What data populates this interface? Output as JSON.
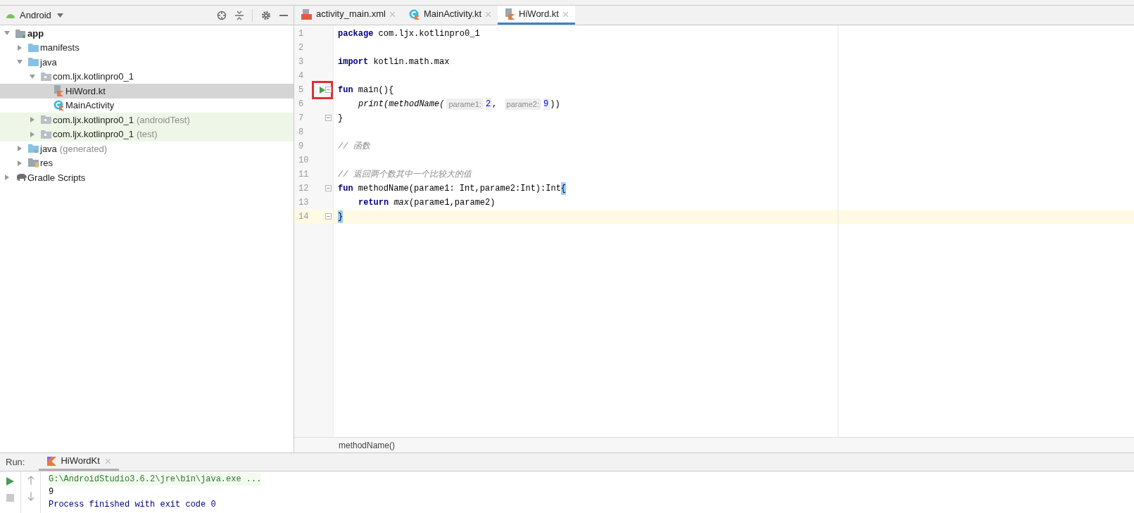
{
  "project_panel": {
    "view": "Android",
    "tree": [
      {
        "label": "app",
        "kind": "module",
        "expanded": true,
        "selected": false,
        "children": [
          {
            "label": "manifests",
            "kind": "folder",
            "expanded": false,
            "selected": false
          },
          {
            "label": "java",
            "kind": "folder",
            "expanded": true,
            "selected": false,
            "children": [
              {
                "label": "com.ljx.kotlinpro0_1",
                "kind": "package",
                "expanded": true,
                "selected": false,
                "children": [
                  {
                    "label": "HiWord.kt",
                    "kind": "kotlin_file",
                    "selected": true
                  },
                  {
                    "label": "MainActivity",
                    "kind": "kotlin_class",
                    "selected": false
                  }
                ]
              },
              {
                "label": "com.ljx.kotlinpro0_1",
                "suffix": "(androidTest)",
                "kind": "test_package",
                "expanded": false,
                "selected": false
              },
              {
                "label": "com.ljx.kotlinpro0_1",
                "suffix": "(test)",
                "kind": "test_package",
                "expanded": false,
                "selected": false
              }
            ]
          },
          {
            "label": "java",
            "suffix": "(generated)",
            "kind": "generated_folder",
            "expanded": false,
            "selected": false
          },
          {
            "label": "res",
            "kind": "res_folder",
            "expanded": false,
            "selected": false
          }
        ]
      },
      {
        "label": "Gradle Scripts",
        "kind": "gradle",
        "expanded": false,
        "selected": false
      }
    ]
  },
  "editor": {
    "tabs": [
      {
        "label": "activity_main.xml",
        "kind": "xml",
        "selected": false
      },
      {
        "label": "MainActivity.kt",
        "kind": "kotlin_class",
        "selected": false
      },
      {
        "label": "HiWord.kt",
        "kind": "kotlin_file",
        "selected": true
      }
    ],
    "lines": [
      {
        "number": "1",
        "segments": [
          {
            "text": "package",
            "kind": "keyword"
          },
          {
            "text": " com.ljx.kotlinpro0_1",
            "kind": "plain"
          }
        ]
      },
      {
        "number": "2"
      },
      {
        "number": "3",
        "segments": [
          {
            "text": "import",
            "kind": "keyword"
          },
          {
            "text": " kotlin.math.max",
            "kind": "plain"
          }
        ]
      },
      {
        "number": "4"
      },
      {
        "number": "5",
        "run_marker": true,
        "marker_boxed": true,
        "fold": true,
        "segments": [
          {
            "text": "fun",
            "kind": "keyword"
          },
          {
            "text": " main(){",
            "kind": "plain"
          }
        ]
      },
      {
        "number": "6",
        "indented": true,
        "segments": [
          {
            "text": "print(methodName(",
            "kind": "italic"
          },
          {
            "text": "parame1:",
            "kind": "hint"
          },
          {
            "text": "2",
            "kind": "number"
          },
          {
            "text": ", ",
            "kind": "plain"
          },
          {
            "text": "parame2:",
            "kind": "hint"
          },
          {
            "text": "9",
            "kind": "number"
          },
          {
            "text": "))",
            "kind": "plain"
          }
        ]
      },
      {
        "number": "7",
        "fold": true,
        "segments": [
          {
            "text": "}",
            "kind": "plain"
          }
        ]
      },
      {
        "number": "8"
      },
      {
        "number": "9",
        "segments": [
          {
            "text": "// 函数",
            "kind": "comment"
          }
        ]
      },
      {
        "number": "10"
      },
      {
        "number": "11",
        "segments": [
          {
            "text": "// 返回两个数其中一个比较大的值",
            "kind": "comment"
          }
        ]
      },
      {
        "number": "12",
        "fold": true,
        "segments": [
          {
            "text": "fun",
            "kind": "keyword"
          },
          {
            "text": " methodName(parame1: Int,parame2:Int):Int",
            "kind": "plain"
          },
          {
            "text": "{",
            "kind": "brace_match"
          }
        ]
      },
      {
        "number": "13",
        "indented": true,
        "segments": [
          {
            "text": "return",
            "kind": "keyword"
          },
          {
            "text": " max",
            "kind": "italic"
          },
          {
            "text": "(parame1,parame2)",
            "kind": "plain"
          }
        ]
      },
      {
        "number": "14",
        "current": true,
        "fold": true,
        "segments": [
          {
            "text": "}",
            "kind": "brace_match"
          }
        ]
      }
    ],
    "breadcrumb": "methodName()"
  },
  "run_panel": {
    "label": "Run:",
    "tab": "HiWordKt",
    "output": [
      {
        "text": "G:\\AndroidStudio3.6.2\\jre\\bin\\java.exe ...",
        "kind": "command"
      },
      {
        "text": "9",
        "kind": "stdout"
      },
      {
        "text": "Process finished with exit code 0",
        "kind": "system"
      }
    ]
  }
}
